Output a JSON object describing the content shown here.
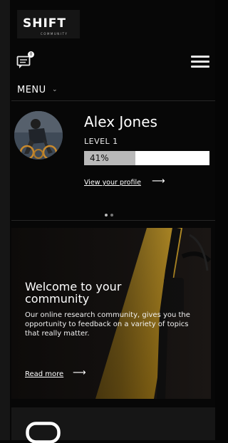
{
  "header": {
    "logo": {
      "main": "SHIFT",
      "sub": "COMMUNITY"
    },
    "chat": {
      "icon": "chat-bubble-icon",
      "badge": "0"
    },
    "menu_icon": "hamburger-icon"
  },
  "nav": {
    "menu_label": "MENU",
    "caret": "⌄"
  },
  "profile": {
    "name": "Alex Jones",
    "level": "LEVEL 1",
    "progress_percent": 41,
    "progress_label": "41%",
    "link_label": "View your profile",
    "link_arrow": "⟶"
  },
  "carousel": {
    "pages": 2,
    "active": 0
  },
  "welcome_card": {
    "title": "Welcome to your community",
    "body": "Our online research community, gives you the opportunity to feedback on a variety of topics that really matter.",
    "link_label": "Read more",
    "link_arrow": "⟶"
  },
  "colors": {
    "background": "#070707",
    "accent_yellow": "#d9ac2c",
    "progress_track": "#ffffff",
    "progress_fill": "#b9b9b9"
  }
}
